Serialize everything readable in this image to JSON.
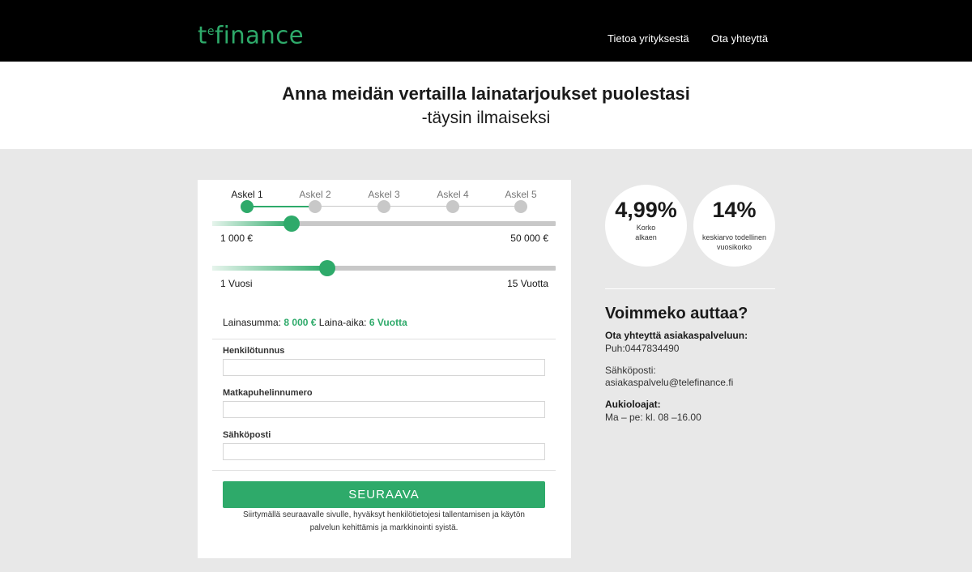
{
  "header": {
    "logo": {
      "t": "t",
      "sup": "e",
      "tail": "finance"
    },
    "nav": [
      "Tietoa yrityksestä",
      "Ota yhteyttä"
    ]
  },
  "hero": {
    "title": "Anna meidän vertailla lainatarjoukset puolestasi",
    "subtitle": "-täysin ilmaiseksi"
  },
  "steps": {
    "items": [
      "Askel 1",
      "Askel 2",
      "Askel 3",
      "Askel 4",
      "Askel 5"
    ],
    "current": 1
  },
  "amount_slider": {
    "min_label": "1 000 €",
    "max_label": "50 000 €",
    "value": 8000,
    "min": 1000,
    "max": 50000
  },
  "term_slider": {
    "min_label": "1 Vuosi",
    "max_label": "15 Vuotta",
    "value": 6,
    "min": 1,
    "max": 15
  },
  "summary": {
    "amount_label": "Lainasumma:",
    "amount_value": "8 000 €",
    "term_label": "Laina-aika:",
    "term_value": "6 Vuotta"
  },
  "form": {
    "fields": [
      {
        "label": "Henkilötunnus",
        "value": ""
      },
      {
        "label": "Matkapuhelinnumero",
        "value": ""
      },
      {
        "label": "Sähköposti",
        "value": ""
      }
    ],
    "submit": "SEURAAVA",
    "consent_line1": "Siirtymällä seuraavalle sivulle, hyväksyt henkilötietojesi tallentamisen ja käytön",
    "consent_line2": "palvelun kehittämis ja markkinointi syistä."
  },
  "stats": [
    {
      "value": "4,99%",
      "line1": "Korko",
      "line2": "alkaen"
    },
    {
      "value": "14%",
      "line1": "keskiarvo todellinen",
      "line2": "vuosikorko"
    }
  ],
  "help": {
    "title": "Voimmeko auttaa?",
    "contact_title": "Ota yhteyttä asiakaspalveluun:",
    "phone": "Puh:0447834490",
    "email_label": "Sähköposti:",
    "email": "asiakaspalvelu@telefinance.fi",
    "hours_title": "Aukioloajat:",
    "hours": "Ma – pe: kl. 08 –16.00"
  },
  "colors": {
    "accent": "#2eaa6a",
    "header_bg": "#000000",
    "page_bg": "#e8e8e8"
  }
}
